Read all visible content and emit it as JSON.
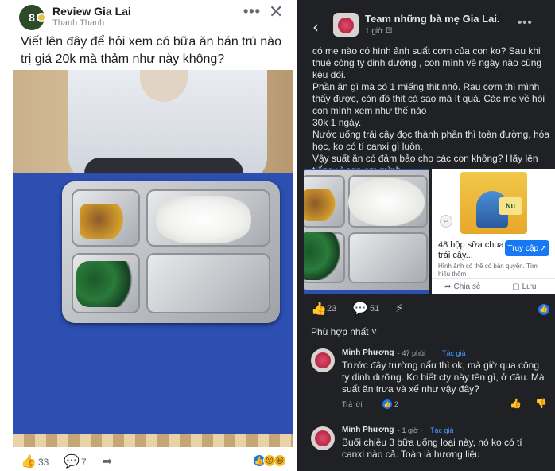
{
  "left_post": {
    "group_name": "Review Gia Lai",
    "author": "Thanh Thanh",
    "avatar_text": "8",
    "text": "Viết lên đây để hỏi xem có bữa ăn bán trú nào trị giá 20k mà thảm như này không?",
    "likes": "33",
    "comments": "7"
  },
  "right_post": {
    "group_name": "Team những bà mẹ Gia Lai.",
    "time": "1 giờ",
    "text_lines": [
      "có mẹ nào có hình ảnh suất cơm của con ko? Sau khi thuê công ty dinh dưỡng , con mình về ngày nào cũng kêu đói.",
      "Phần ăn gì mà có 1 miếng thịt nhỏ. Rau cơm thì mình thấy được, còn đồ thịt cá sao mà ít quá. Các mẹ về hỏi con mình xem như thế nào",
      "30k 1 ngày.",
      "Nước uống trái cây đọc thành phần thì toàn đường, hóa học, ko có tí canxi gì luôn.",
      "Vậy suất ăn có đảm bảo cho các con không? Hãy lên tiếng vì con em mình"
    ],
    "ad": {
      "title": "48 hộp sữa chua trái cây...",
      "button": "Truy cập",
      "note": "Hình ảnh có thể có bản quyền. Tìm hiểu thêm",
      "share": "Chia sẻ",
      "save": "Lưu",
      "badge": "Nu"
    },
    "likes": "23",
    "comments": "51",
    "sort_label": "Phù hợp nhất"
  },
  "comments": [
    {
      "name": "Minh Phương",
      "meta": "· 47 phút ·",
      "author_tag": "Tác giả",
      "text": "Trước đây trường nấu thì ok, mà giờ qua công ty dinh dưỡng. Ko biết cty này tên gì, ở đâu. Mà suất ăn trưa và xế như vậy đây?",
      "reply": "Trả lời",
      "reactions": "2"
    },
    {
      "name": "Minh Phương",
      "meta": "· 1 giờ ·",
      "author_tag": "Tác giả",
      "text": "Buổi chiều 3 bữa uống loại này, nó ko có tí canxi nào cả. Toàn là hương liệu"
    }
  ],
  "icons": {
    "like": "like-icon",
    "comment": "comment-icon",
    "share": "share-icon",
    "close": "close-icon",
    "more": "more-icon",
    "back": "back-arrow-icon",
    "globe": "globe-icon",
    "messenger": "messenger-icon",
    "search": "lens-icon"
  },
  "colors": {
    "accent": "#1877f2",
    "dark_bg": "#1f2125",
    "light_bg": "#ffffff"
  }
}
